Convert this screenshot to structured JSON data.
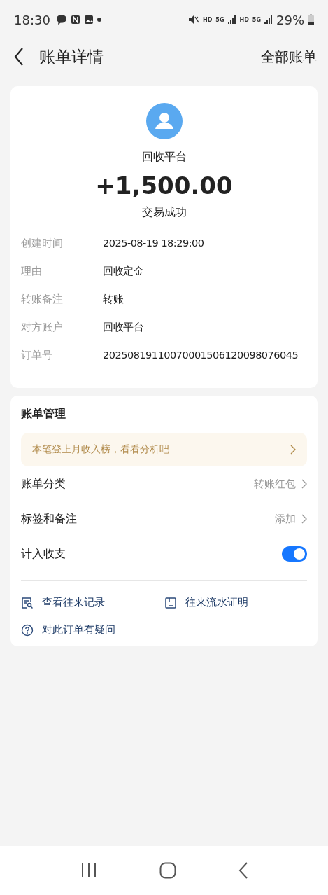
{
  "status_bar": {
    "time": "18:30",
    "network_labels": [
      "HD",
      "5G",
      "HD",
      "5G"
    ],
    "battery": "29%"
  },
  "header": {
    "title": "账单详情",
    "action": "全部账单"
  },
  "summary": {
    "counterparty": "回收平台",
    "amount": "+1,500.00",
    "status": "交易成功"
  },
  "details": [
    {
      "label": "创建时间",
      "value": "2025-08-19 18:29:00"
    },
    {
      "label": "理由",
      "value": "回收定金"
    },
    {
      "label": "转账备注",
      "value": "转账"
    },
    {
      "label": "对方账户",
      "value": "回收平台"
    },
    {
      "label": "订单号",
      "value": "20250819110070001506120098076045"
    }
  ],
  "management": {
    "title": "账单管理",
    "banner": "本笔登上月收入榜，看看分析吧",
    "items": [
      {
        "kind": "link",
        "label": "账单分类",
        "value": "转账红包"
      },
      {
        "kind": "link",
        "label": "标签和备注",
        "value": "添加"
      },
      {
        "kind": "toggle",
        "label": "计入收支",
        "on": true
      }
    ],
    "actions": [
      {
        "kind": "records",
        "label": "查看往来记录"
      },
      {
        "kind": "proof",
        "label": "往来流水证明"
      },
      {
        "kind": "question",
        "label": "对此订单有疑问"
      }
    ]
  }
}
